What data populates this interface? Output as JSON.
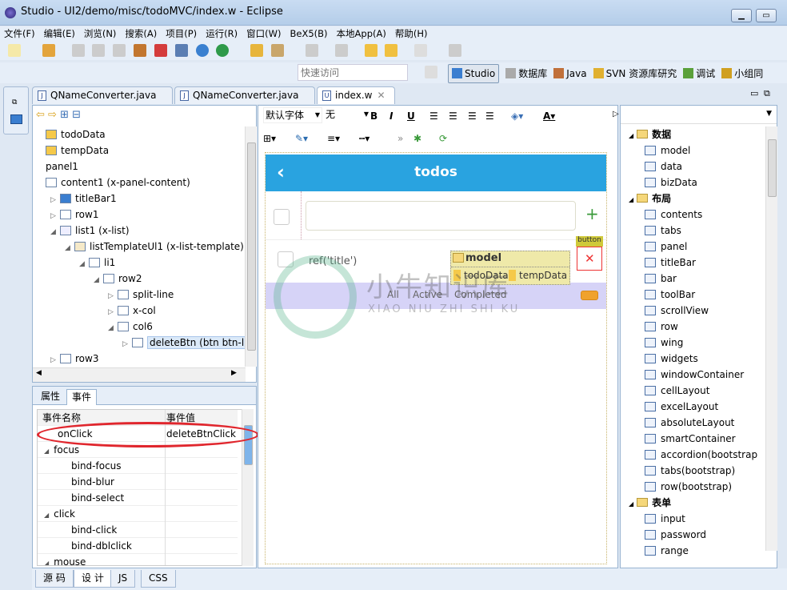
{
  "window": {
    "title": "Studio - UI2/demo/misc/todoMVC/index.w - Eclipse"
  },
  "menu": [
    "文件(F)",
    "编辑(E)",
    "浏览(N)",
    "搜索(A)",
    "项目(P)",
    "运行(R)",
    "窗口(W)",
    "BeX5(B)",
    "本地App(A)",
    "帮助(H)"
  ],
  "quick_access": {
    "placeholder": "快速访问"
  },
  "perspectives": [
    "Studio",
    "数据库",
    "Java",
    "SVN 资源库研究",
    "调试",
    "小组同"
  ],
  "editor_tabs": [
    {
      "label": "QNameConverter.java",
      "active": false
    },
    {
      "label": "QNameConverter.java",
      "active": false
    },
    {
      "label": "index.w",
      "active": true
    }
  ],
  "outline": [
    {
      "label": "todoData",
      "indent": 0,
      "toggle": "",
      "icon": "data-icon"
    },
    {
      "label": "tempData",
      "indent": 0,
      "toggle": "",
      "icon": "data-icon"
    },
    {
      "label": "panel1",
      "indent": 0,
      "toggle": "",
      "icon": ""
    },
    {
      "label": "content1 (x-panel-content)",
      "indent": 0,
      "toggle": "",
      "icon": "box-icon"
    },
    {
      "label": "titleBar1",
      "indent": 1,
      "toggle": "▷",
      "icon": "titlebar-icon"
    },
    {
      "label": "row1",
      "indent": 1,
      "toggle": "▷",
      "icon": "row-icon"
    },
    {
      "label": "list1 (x-list)",
      "indent": 1,
      "toggle": "◢",
      "icon": "list-icon"
    },
    {
      "label": "listTemplateUl1 (x-list-template)",
      "indent": 2,
      "toggle": "◢",
      "icon": "template-icon"
    },
    {
      "label": "li1",
      "indent": 3,
      "toggle": "◢",
      "icon": "tag-icon"
    },
    {
      "label": "row2",
      "indent": 4,
      "toggle": "◢",
      "icon": "row-icon"
    },
    {
      "label": "split-line",
      "indent": 5,
      "toggle": "▷",
      "icon": "col-icon"
    },
    {
      "label": "x-col",
      "indent": 5,
      "toggle": "▷",
      "icon": "col-icon"
    },
    {
      "label": "col6",
      "indent": 5,
      "toggle": "◢",
      "icon": "col-icon"
    },
    {
      "label": "deleteBtn (btn btn-lin",
      "indent": 6,
      "toggle": "▷",
      "icon": "button-icon",
      "selected": true
    },
    {
      "label": "row3",
      "indent": 1,
      "toggle": "▷",
      "icon": "row-icon"
    }
  ],
  "props_tabs": [
    "属性",
    "事件"
  ],
  "events": {
    "headers": [
      "事件名称",
      "事件值"
    ],
    "rows": [
      {
        "name": "onClick",
        "value": "deleteBtnClick",
        "indent": 1,
        "toggle": ""
      },
      {
        "name": "focus",
        "value": "",
        "indent": 0,
        "toggle": "◢"
      },
      {
        "name": "bind-focus",
        "value": "",
        "indent": 2,
        "toggle": ""
      },
      {
        "name": "bind-blur",
        "value": "",
        "indent": 2,
        "toggle": ""
      },
      {
        "name": "bind-select",
        "value": "",
        "indent": 2,
        "toggle": ""
      },
      {
        "name": "click",
        "value": "",
        "indent": 0,
        "toggle": "◢"
      },
      {
        "name": "bind-click",
        "value": "",
        "indent": 2,
        "toggle": ""
      },
      {
        "name": "bind-dblclick",
        "value": "",
        "indent": 2,
        "toggle": ""
      },
      {
        "name": "mouse",
        "value": "",
        "indent": 0,
        "toggle": "◢"
      }
    ]
  },
  "format_toolbar": {
    "font": "默认字体",
    "size": "无"
  },
  "design": {
    "title": "todos",
    "input_value": "",
    "item_text": "ref('title')",
    "filters": [
      "All",
      "Active",
      "Completed"
    ],
    "badge": "button",
    "model_popup": {
      "title": "model",
      "items": [
        "todoData",
        "tempData"
      ]
    },
    "accent": "#29a3e0"
  },
  "palette": [
    {
      "label": "数据",
      "group": true
    },
    {
      "label": "model"
    },
    {
      "label": "data"
    },
    {
      "label": "bizData"
    },
    {
      "label": "布局",
      "group": true
    },
    {
      "label": "contents"
    },
    {
      "label": "tabs"
    },
    {
      "label": "panel"
    },
    {
      "label": "titleBar"
    },
    {
      "label": "bar"
    },
    {
      "label": "toolBar"
    },
    {
      "label": "scrollView"
    },
    {
      "label": "row"
    },
    {
      "label": "wing"
    },
    {
      "label": "widgets"
    },
    {
      "label": "windowContainer"
    },
    {
      "label": "cellLayout"
    },
    {
      "label": "excelLayout"
    },
    {
      "label": "absoluteLayout"
    },
    {
      "label": "smartContainer"
    },
    {
      "label": "accordion(bootstrap"
    },
    {
      "label": "tabs(bootstrap)"
    },
    {
      "label": "row(bootstrap)"
    },
    {
      "label": "表单",
      "group": true
    },
    {
      "label": "input"
    },
    {
      "label": "password"
    },
    {
      "label": "range"
    }
  ],
  "bottom_tabs": [
    {
      "label": "源 码",
      "active": false
    },
    {
      "label": "设 计",
      "active": true
    },
    {
      "label": "JS",
      "active": false
    },
    {
      "label": "CSS",
      "active": false
    }
  ],
  "watermark": {
    "cn": "小牛知识库",
    "en": "XIAO NIU ZHI SHI KU"
  }
}
